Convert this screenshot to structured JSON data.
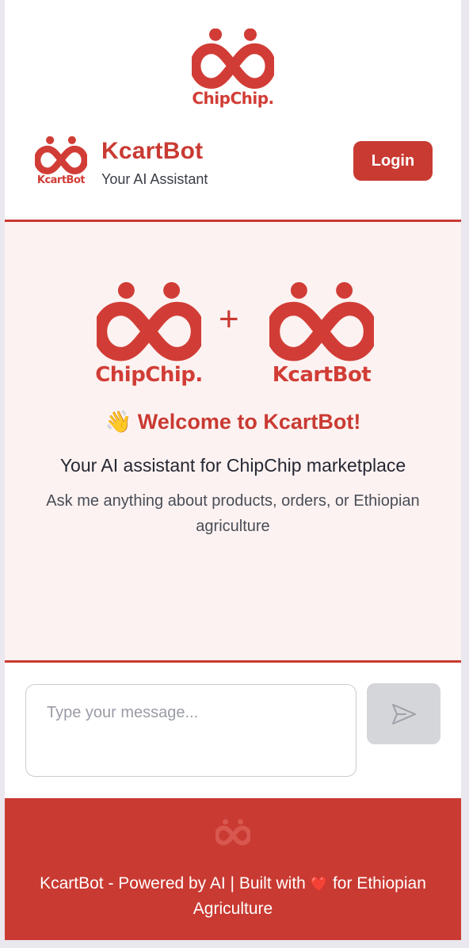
{
  "top_logo": {
    "wordmark": "ChipChip."
  },
  "header": {
    "logo_wordmark": "KcartBot",
    "brand_name": "KcartBot",
    "brand_subtitle": "Your AI Assistant",
    "login_label": "Login"
  },
  "hero": {
    "left_logo_wordmark": "ChipChip.",
    "plus": "+",
    "right_logo_wordmark": "KcartBot",
    "welcome_emoji": "👋",
    "welcome_title": "Welcome to KcartBot!",
    "tagline": "Your AI assistant for ChipChip marketplace",
    "hint": "Ask me anything about products, orders, or Ethiopian agriculture"
  },
  "composer": {
    "input_value": "",
    "input_placeholder": "Type your message...",
    "send_icon": "paper-plane-icon"
  },
  "footer": {
    "text_before": "KcartBot - Powered by AI | Built with",
    "heart": "❤️",
    "text_after": "for Ethiopian Agriculture"
  },
  "colors": {
    "brand_red": "#c93a32",
    "hero_bg": "#fcf2f1",
    "send_disabled": "#d4d6da"
  }
}
